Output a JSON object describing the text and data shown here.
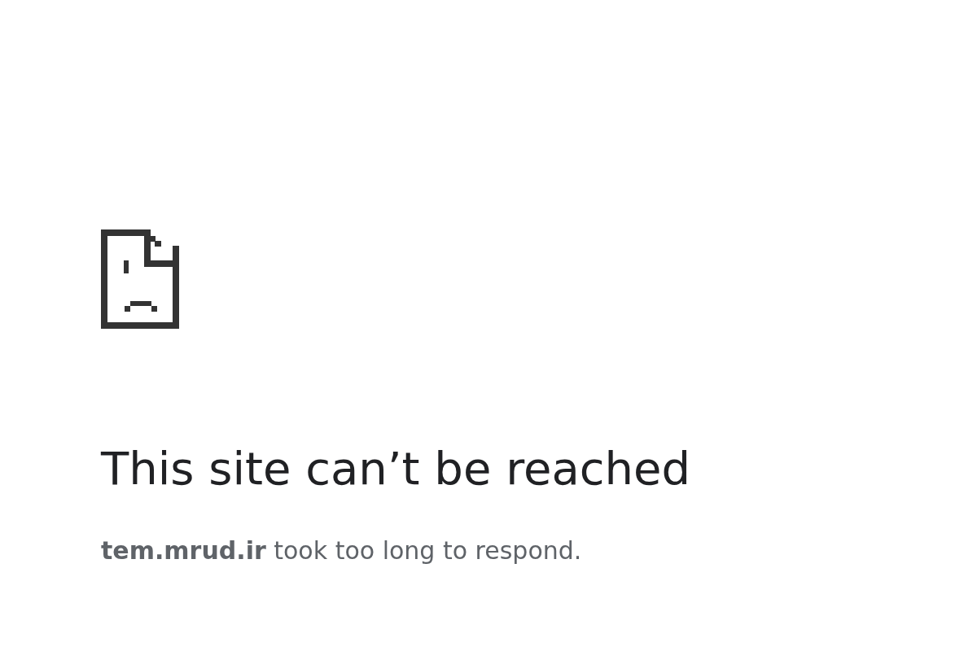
{
  "heading": "This site can’t be reached",
  "message": "**tem.mrud.ir** took too long to respond."
}
